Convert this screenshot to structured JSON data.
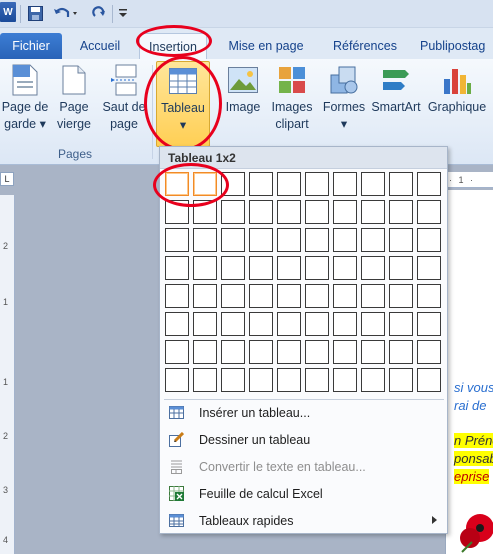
{
  "qat": {
    "app_icon_letter": "W",
    "icons": [
      "word-icon",
      "save-icon",
      "undo-icon",
      "redo-icon",
      "customize-qat-icon"
    ]
  },
  "tabs": [
    {
      "label": "Fichier"
    },
    {
      "label": "Accueil"
    },
    {
      "label": "Insertion",
      "active": true
    },
    {
      "label": "Mise en page"
    },
    {
      "label": "Références"
    },
    {
      "label": "Publipostag"
    }
  ],
  "ribbon": {
    "group_pages_label": "Pages",
    "buttons": [
      {
        "line1": "Page de",
        "line2": "garde ▾",
        "icon": "cover-page-icon"
      },
      {
        "line1": "Page",
        "line2": "vierge",
        "icon": "blank-page-icon"
      },
      {
        "line1": "Saut de",
        "line2": "page",
        "icon": "page-break-icon"
      },
      {
        "line1": "Tableau",
        "line2": "▾",
        "icon": "table-icon"
      },
      {
        "line1": "Image",
        "line2": "",
        "icon": "picture-icon"
      },
      {
        "line1": "Images",
        "line2": "clipart",
        "icon": "clipart-icon"
      },
      {
        "line1": "Formes",
        "line2": "▾",
        "icon": "shapes-icon"
      },
      {
        "line1": "SmartArt",
        "line2": "",
        "icon": "smartart-icon"
      },
      {
        "line1": "Graphique",
        "line2": "",
        "icon": "chart-icon"
      }
    ]
  },
  "rulers": {
    "corner": "L",
    "horizontal": "· 1 ·",
    "vertical_ticks": [
      "2",
      "1",
      "1",
      "2",
      "3",
      "4"
    ]
  },
  "document": {
    "lines": [
      "si vous",
      "rai de",
      "n Prénc",
      "ponsab",
      "eprise"
    ]
  },
  "table_menu": {
    "title": "Tableau 1x2",
    "grid": {
      "columns": 10,
      "rows": 8,
      "selected_rows": 1,
      "selected_cols": 2
    },
    "items": [
      {
        "label": "Insérer un tableau...",
        "icon": "insert-table-icon",
        "enabled": true
      },
      {
        "label": "Dessiner un tableau",
        "icon": "draw-table-icon",
        "enabled": true
      },
      {
        "label": "Convertir le texte en tableau...",
        "icon": "convert-text-icon",
        "enabled": false
      },
      {
        "label": "Feuille de calcul Excel",
        "icon": "excel-sheet-icon",
        "enabled": true
      },
      {
        "label": "Tableaux rapides",
        "icon": "quick-tables-icon",
        "enabled": true,
        "submenu": true
      }
    ]
  },
  "colors": {
    "highlight_annotation": "#e8001d",
    "tableau_button": "#ffd86e",
    "selected_cell_border": "#f08a28",
    "fichier_tab": "#2f6fc8"
  }
}
